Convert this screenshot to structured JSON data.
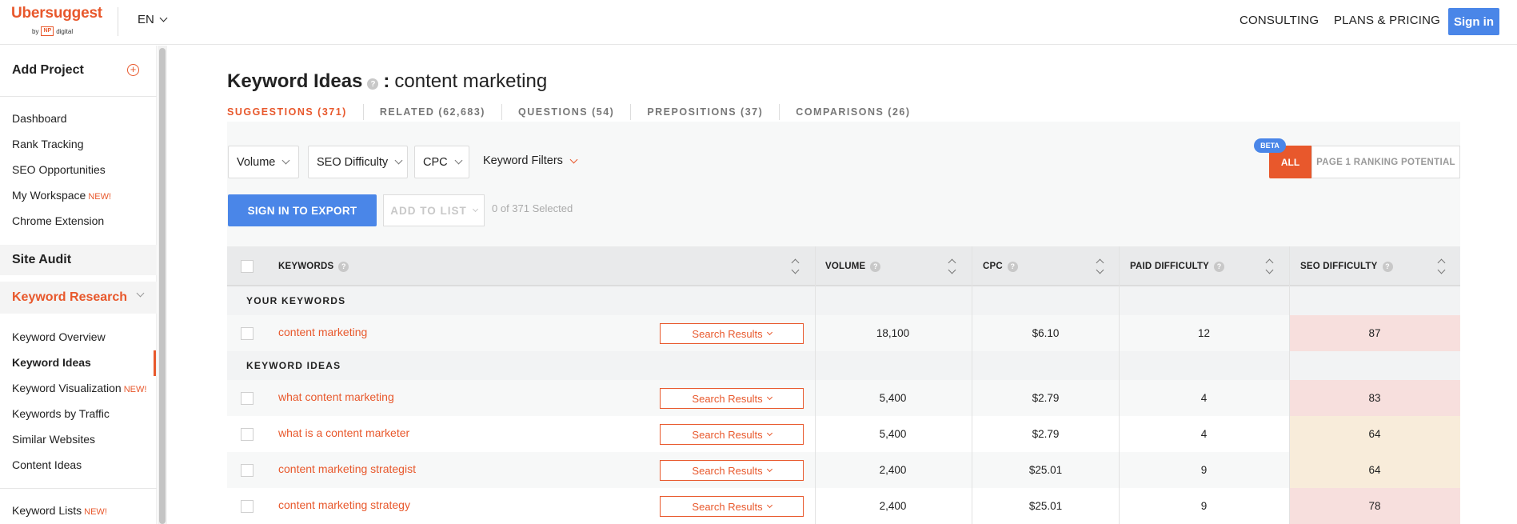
{
  "header": {
    "logo": "Ubersuggest",
    "logo_by": "by",
    "logo_np": "NP",
    "logo_digital": "digital",
    "language": "EN",
    "consulting": "CONSULTING",
    "plans": "PLANS & PRICING",
    "signin": "Sign in",
    "accent_color": "#e8582c",
    "primary_color": "#4a86e8"
  },
  "sidebar": {
    "add_project": "Add Project",
    "project_items": [
      {
        "label": "Dashboard"
      },
      {
        "label": "Rank Tracking"
      },
      {
        "label": "SEO Opportunities"
      },
      {
        "label": "My Workspace",
        "badge": "NEW!"
      },
      {
        "label": "Chrome Extension"
      }
    ],
    "site_audit": "Site Audit",
    "keyword_research": "Keyword Research",
    "research_items": [
      {
        "label": "Keyword Overview"
      },
      {
        "label": "Keyword Ideas",
        "active": true
      },
      {
        "label": "Keyword Visualization",
        "badge": "NEW!"
      },
      {
        "label": "Keywords by Traffic"
      },
      {
        "label": "Similar Websites"
      },
      {
        "label": "Content Ideas"
      }
    ],
    "keyword_lists": "Keyword Lists",
    "keyword_lists_badge": "NEW!"
  },
  "main": {
    "title_bold": "Keyword Ideas",
    "title_colon": ":",
    "title_query": "content marketing",
    "tabs": [
      {
        "label": "SUGGESTIONS (371)",
        "active": true
      },
      {
        "label": "RELATED (62,683)"
      },
      {
        "label": "QUESTIONS (54)"
      },
      {
        "label": "PREPOSITIONS (37)"
      },
      {
        "label": "COMPARISONS (26)"
      }
    ],
    "filters": {
      "volume": "Volume",
      "seo_difficulty": "SEO Difficulty",
      "cpc": "CPC",
      "keyword_filters": "Keyword Filters",
      "beta": "BETA",
      "all": "ALL",
      "page1": "PAGE 1 RANKING POTENTIAL"
    },
    "actions": {
      "export": "SIGN IN TO EXPORT",
      "add_to_list": "ADD TO LIST",
      "selected": "0 of 371 Selected"
    }
  },
  "table": {
    "headers": {
      "keywords": "KEYWORDS",
      "volume": "VOLUME",
      "cpc": "CPC",
      "paid_difficulty": "PAID DIFFICULTY",
      "seo_difficulty": "SEO DIFFICULTY"
    },
    "search_results_label": "Search Results",
    "your_keywords_label": "YOUR KEYWORDS",
    "keyword_ideas_label": "KEYWORD IDEAS",
    "your_keywords": [
      {
        "keyword": "content marketing",
        "volume": "18,100",
        "cpc": "$6.10",
        "pd": "12",
        "sd": "87",
        "sd_color": "#f7dfdd"
      }
    ],
    "keyword_ideas": [
      {
        "keyword": "what content marketing",
        "volume": "5,400",
        "cpc": "$2.79",
        "pd": "4",
        "sd": "83",
        "sd_color": "#f7dfdd"
      },
      {
        "keyword": "what is a content marketer",
        "volume": "5,400",
        "cpc": "$2.79",
        "pd": "4",
        "sd": "64",
        "sd_color": "#f8ecda"
      },
      {
        "keyword": "content marketing strategist",
        "volume": "2,400",
        "cpc": "$25.01",
        "pd": "9",
        "sd": "64",
        "sd_color": "#f8ecda"
      },
      {
        "keyword": "content marketing strategy",
        "volume": "2,400",
        "cpc": "$25.01",
        "pd": "9",
        "sd": "78",
        "sd_color": "#f7dfdd"
      }
    ]
  }
}
